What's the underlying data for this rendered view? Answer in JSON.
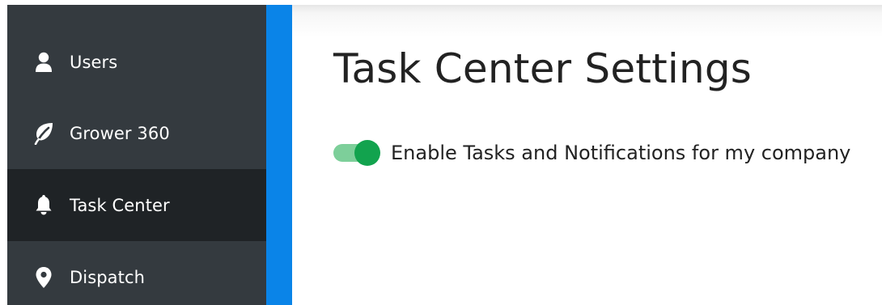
{
  "sidebar": {
    "items": [
      {
        "label": "Users",
        "icon": "user-icon",
        "active": false
      },
      {
        "label": "Grower 360",
        "icon": "leaf-icon",
        "active": false
      },
      {
        "label": "Task Center",
        "icon": "bell-icon",
        "active": true
      },
      {
        "label": "Dispatch",
        "icon": "map-pin-icon",
        "active": false
      }
    ]
  },
  "main": {
    "title": "Task Center Settings",
    "settings": [
      {
        "label": "Enable Tasks and Notifications for my company",
        "enabled": true
      }
    ]
  },
  "colors": {
    "sidebar_bg": "#343a3f",
    "sidebar_active_bg": "#1f2326",
    "accent": "#0a84e8",
    "toggle_on": "#12a34e",
    "toggle_track": "#7dcf9a"
  }
}
